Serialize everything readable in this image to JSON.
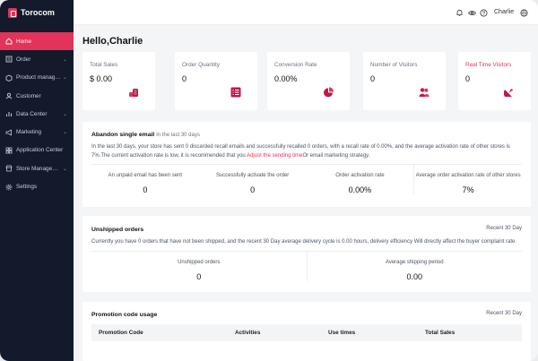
{
  "brand": {
    "name": "Torocom"
  },
  "sidebar": {
    "items": [
      {
        "label": "Home",
        "icon": "home-icon",
        "active": true,
        "has_children": false
      },
      {
        "label": "Order",
        "icon": "order-icon",
        "active": false,
        "has_children": true
      },
      {
        "label": "Product manage...",
        "icon": "product-icon",
        "active": false,
        "has_children": true
      },
      {
        "label": "Customer",
        "icon": "customer-icon",
        "active": false,
        "has_children": false
      },
      {
        "label": "Data Center",
        "icon": "data-center-icon",
        "active": false,
        "has_children": true
      },
      {
        "label": "Marketing",
        "icon": "marketing-icon",
        "active": false,
        "has_children": true
      },
      {
        "label": "Application Center",
        "icon": "application-icon",
        "active": false,
        "has_children": false
      },
      {
        "label": "Store Managem...",
        "icon": "store-icon",
        "active": false,
        "has_children": true
      },
      {
        "label": "Settings",
        "icon": "settings-icon",
        "active": false,
        "has_children": false
      }
    ]
  },
  "topbar": {
    "user_name": "Charlie"
  },
  "greeting": "Hello,Charlie",
  "stats": [
    {
      "label": "Total Sales",
      "value": "$ 0.00",
      "icon": "coins-icon",
      "highlight": false
    },
    {
      "label": "Order Quantity",
      "value": "0",
      "icon": "list-icon",
      "highlight": false
    },
    {
      "label": "Conversion Rate",
      "value": "0.00%",
      "icon": "pie-chart-icon",
      "highlight": false
    },
    {
      "label": "Number of Visitors",
      "value": "0",
      "icon": "visitors-icon",
      "highlight": false
    },
    {
      "label": "Real Time Visitors",
      "value": "0",
      "icon": "satellite-icon",
      "highlight": true
    }
  ],
  "abandon": {
    "title": "Abandon single email",
    "subtitle": "In the last 30 days",
    "desc_before": "In the last 30 days, your store has sent 0 discarded recall emails and successfully recalled 0 orders, with a recall rate of 0.00%, and the average activation rate of other stores is 7%.The current activation rate is low, it is recommended that you ",
    "desc_link": "Adjust the sending time",
    "desc_after": "Or email marketing strategy.",
    "metrics": [
      {
        "label": "An unpaid email has been sent",
        "value": "0"
      },
      {
        "label": "Successfully activate the order",
        "value": "0"
      },
      {
        "label": "Order activation rate",
        "value": "0.00%"
      },
      {
        "label": "Average order activation rate of other stores",
        "value": "7%"
      }
    ]
  },
  "unshipped": {
    "title": "Unshipped orders",
    "recent": "Recent 30 Day",
    "desc": "Currently you have 0 orders that have not been shipped, and the recent 30 Day average delivery cycle is 0.00 hours, delivery efficiency Will directly affect the buyer complaint rate.",
    "metrics": [
      {
        "label": "Unshipped orders",
        "value": "0"
      },
      {
        "label": "Average shipping period",
        "value": "0.00"
      }
    ]
  },
  "promotion": {
    "title": "Promotion code usage",
    "recent": "Recent 30 Day",
    "columns": [
      "Promotion Code",
      "Activities",
      "Use times",
      "Total Sales"
    ]
  },
  "colors": {
    "accent": "#e2335b",
    "sidebar": "#121a2c",
    "background": "#f4f5f7"
  }
}
